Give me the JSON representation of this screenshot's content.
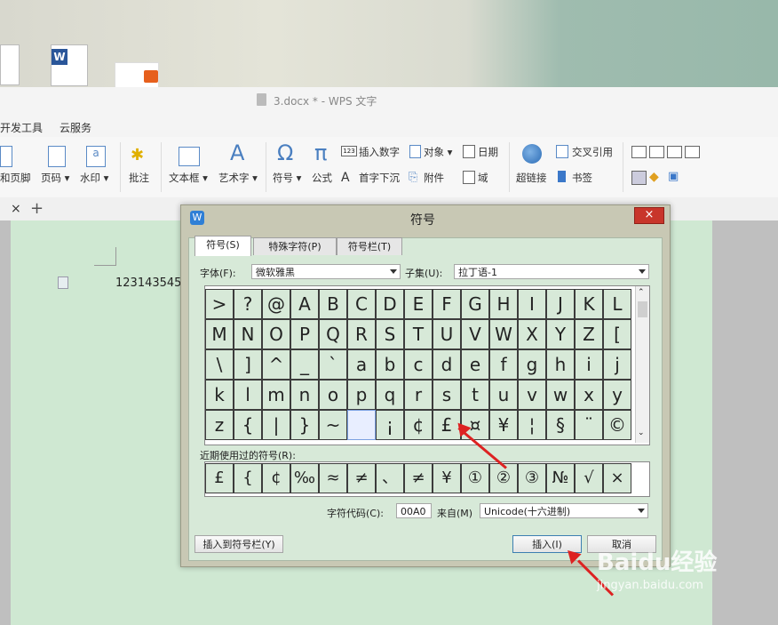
{
  "window": {
    "title": "3.docx * - WPS 文字"
  },
  "menu": {
    "items": [
      "开发工具",
      "云服务"
    ]
  },
  "ribbon": {
    "buttons": [
      "和页脚",
      "页码",
      "水印",
      "批注",
      "文本框",
      "艺术字",
      "符号",
      "公式"
    ],
    "small": {
      "insert_number": "插入数字",
      "object": "对象",
      "date": "日期",
      "dropcap": "首字下沉",
      "attachment": "附件",
      "field": "域",
      "hyperlink": "超链接",
      "crossref": "交叉引用",
      "bookmark": "书签"
    }
  },
  "doc": {
    "text": "123143545"
  },
  "dialog": {
    "title": "符号",
    "close_label": "×",
    "tabs": [
      "符号(S)",
      "特殊字符(P)",
      "符号栏(T)"
    ],
    "font_label": "字体(F):",
    "font_value": "微软雅黑",
    "subset_label": "子集(U):",
    "subset_value": "拉丁语-1",
    "symbols": [
      [
        ">",
        "?",
        "@",
        "A",
        "B",
        "C",
        "D",
        "E",
        "F",
        "G",
        "H",
        "I",
        "J",
        "K",
        "L"
      ],
      [
        "M",
        "N",
        "O",
        "P",
        "Q",
        "R",
        "S",
        "T",
        "U",
        "V",
        "W",
        "X",
        "Y",
        "Z",
        "["
      ],
      [
        "\\",
        "]",
        "^",
        "_",
        "`",
        "a",
        "b",
        "c",
        "d",
        "e",
        "f",
        "g",
        "h",
        "i",
        "j"
      ],
      [
        "k",
        "l",
        "m",
        "n",
        "o",
        "p",
        "q",
        "r",
        "s",
        "t",
        "u",
        "v",
        "w",
        "x",
        "y"
      ],
      [
        "z",
        "{",
        "|",
        "}",
        "~",
        "",
        "¡",
        "¢",
        "£",
        "¤",
        "¥",
        "¦",
        "§",
        "¨",
        "©"
      ]
    ],
    "recent_label": "近期使用过的符号(R):",
    "recent": [
      "£",
      "{",
      "¢",
      "‰",
      "≈",
      "≠",
      "、",
      "≠",
      "¥",
      "①",
      "②",
      "③",
      "№",
      "√",
      "×"
    ],
    "code_label": "字符代码(C):",
    "code_value": "00A0",
    "from_label": "来自(M)",
    "from_value": "Unicode(十六进制)",
    "insert_to_bar": "插入到符号栏(Y)",
    "insert": "插入(I)",
    "cancel": "取消"
  },
  "tabstrip": {
    "close": "×",
    "add": "+"
  },
  "watermark": {
    "brand": "Baidu经验",
    "url": "jingyan.baidu.com"
  },
  "colors": {
    "accent_red": "#d22222",
    "dialog_bg": "#d7e9d8",
    "page_bg": "#cfe8d2"
  }
}
